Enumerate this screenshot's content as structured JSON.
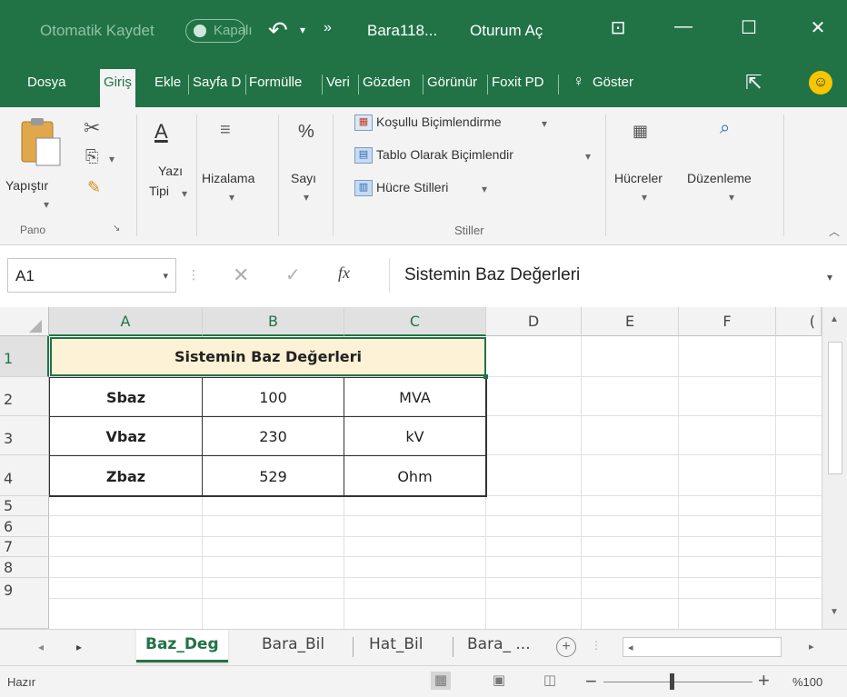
{
  "titlebar": {
    "autosave_label": "Otomatik Kaydet",
    "autosave_state": "Kapalı",
    "document_name": "Bara118...",
    "signin_label": "Oturum Aç"
  },
  "tabs": [
    {
      "label": "Dosya"
    },
    {
      "label": "Giriş",
      "active": true
    },
    {
      "label": "Ekle"
    },
    {
      "label": "Sayfa D"
    },
    {
      "label": "Formülle"
    },
    {
      "label": "Veri"
    },
    {
      "label": "Gözden"
    },
    {
      "label": "Görünür"
    },
    {
      "label": "Foxit PD"
    },
    {
      "label": "Göster"
    }
  ],
  "ribbon": {
    "paste_label": "Yapıştır",
    "clipboard_group": "Pano",
    "font_label_1": "Yazı",
    "font_label_2": "Tipi",
    "alignment_label": "Hizalama",
    "number_label": "Sayı",
    "conditional_formatting": "Koşullu Biçimlendirme",
    "format_as_table": "Tablo Olarak Biçimlendir",
    "cell_styles": "Hücre Stilleri",
    "styles_group": "Stiller",
    "cells_label": "Hücreler",
    "editing_label": "Düzenleme"
  },
  "formula_bar": {
    "name_box": "A1",
    "value": "Sistemin Baz Değerleri"
  },
  "grid": {
    "columns": [
      "A",
      "B",
      "C",
      "D",
      "E",
      "F",
      "("
    ],
    "rows": [
      "1",
      "2",
      "3",
      "4",
      "5",
      "6",
      "7",
      "8",
      "9"
    ],
    "title": "Sistemin Baz Değerleri",
    "data": [
      {
        "name": "Sbaz",
        "value": "100",
        "unit": "MVA"
      },
      {
        "name": "Vbaz",
        "value": "230",
        "unit": "kV"
      },
      {
        "name": "Zbaz",
        "value": "529",
        "unit": "Ohm"
      }
    ]
  },
  "sheets": {
    "tabs": [
      "Baz_Deg",
      "Bara_Bil",
      "Hat_Bil",
      "Bara_ ..."
    ],
    "active": "Baz_Deg"
  },
  "status": {
    "state": "Hazır",
    "zoom": "%100"
  },
  "colors": {
    "excel_green": "#217346",
    "title_fill": "#fdf1d6"
  }
}
